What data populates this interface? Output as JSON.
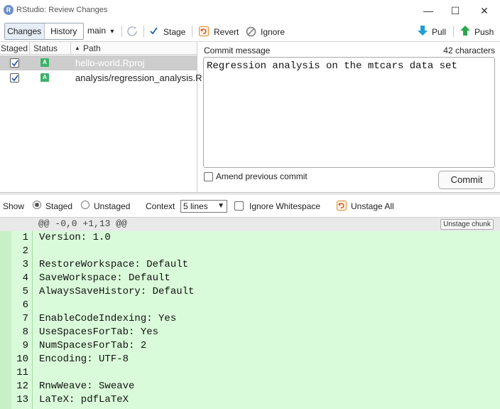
{
  "window": {
    "app_icon_letter": "R",
    "title": "RStudio: Review Changes",
    "controls": {
      "minimize": "—",
      "maximize": "☐",
      "close": "✕"
    }
  },
  "toolbar": {
    "changes_label": "Changes",
    "history_label": "History",
    "branch": "main",
    "branch_arrow": "▾",
    "stage_label": "Stage",
    "revert_label": "Revert",
    "ignore_label": "Ignore",
    "pull_label": "Pull",
    "push_label": "Push"
  },
  "file_list": {
    "headers": {
      "staged": "Staged",
      "status": "Status",
      "path": "Path",
      "sort_icon": "▲"
    },
    "rows": [
      {
        "staged": true,
        "status": "A",
        "path": "hello-world.Rproj",
        "selected": true
      },
      {
        "staged": true,
        "status": "A",
        "path": "analysis/regression_analysis.R",
        "selected": false
      }
    ]
  },
  "commit": {
    "message_label": "Commit message",
    "char_count": "42 characters",
    "message": "Regression analysis on the mtcars data set",
    "amend_label": "Amend previous commit",
    "commit_button": "Commit"
  },
  "diff_toolbar": {
    "show_label": "Show",
    "staged_label": "Staged",
    "unstaged_label": "Unstaged",
    "context_label": "Context",
    "context_value": "5 lines",
    "ignore_whitespace_label": "Ignore Whitespace",
    "unstage_all_label": "Unstage All"
  },
  "diff": {
    "hunk_header": "@@ -0,0 +1,13 @@",
    "unstage_chunk_label": "Unstage chunk",
    "lines": [
      {
        "num": "1",
        "text": "Version: 1.0"
      },
      {
        "num": "2",
        "text": ""
      },
      {
        "num": "3",
        "text": "RestoreWorkspace: Default"
      },
      {
        "num": "4",
        "text": "SaveWorkspace: Default"
      },
      {
        "num": "5",
        "text": "AlwaysSaveHistory: Default"
      },
      {
        "num": "6",
        "text": ""
      },
      {
        "num": "7",
        "text": "EnableCodeIndexing: Yes"
      },
      {
        "num": "8",
        "text": "UseSpacesForTab: Yes"
      },
      {
        "num": "9",
        "text": "NumSpacesForTab: 2"
      },
      {
        "num": "10",
        "text": "Encoding: UTF-8"
      },
      {
        "num": "11",
        "text": ""
      },
      {
        "num": "12",
        "text": "RnwWeave: Sweave"
      },
      {
        "num": "13",
        "text": "LaTeX: pdfLaTeX"
      }
    ]
  },
  "colors": {
    "diff_added_bg": "#d9fbd9",
    "pull_arrow": "#1f9fd6",
    "push_arrow": "#2aa84a",
    "status_added": "#3bb36a",
    "selected_row": "#cdcdcd"
  }
}
